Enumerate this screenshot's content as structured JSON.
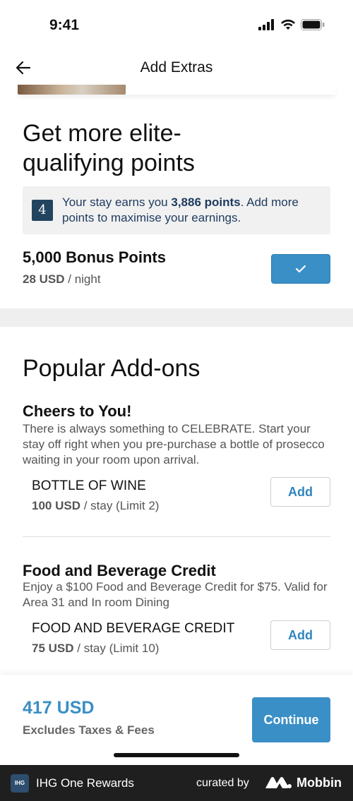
{
  "status_bar": {
    "time": "9:41"
  },
  "nav": {
    "title": "Add Extras"
  },
  "points_section": {
    "title_line1": "Get more elite-",
    "title_line2": "qualifying points",
    "info_prefix": "Your stay earns you ",
    "info_points": "3,886 points",
    "info_suffix": ". Add more points to maximise your earnings.",
    "bonus_title": "5,000 Bonus Points",
    "bonus_price": "28 USD",
    "bonus_unit": " / night",
    "selected": true
  },
  "popular": {
    "title": "Popular Add-ons",
    "addons": [
      {
        "heading": "Cheers to You!",
        "description": "There is always something to CELEBRATE. Start your stay off right when you pre-purchase a bottle of prosecco waiting in your room upon arrival.",
        "item": "BOTTLE OF WINE",
        "price": "100 USD",
        "unit": " / stay (Limit 2)",
        "button": "Add"
      },
      {
        "heading": "Food and Beverage Credit",
        "description": "Enjoy a $100 Food and Beverage Credit for $75. Valid for Area 31 and In room Dining",
        "item": "FOOD AND BEVERAGE CREDIT",
        "price": "75 USD",
        "unit": " / stay (Limit 10)",
        "button": "Add"
      }
    ]
  },
  "footer": {
    "total": "417 USD",
    "note": "Excludes Taxes & Fees",
    "continue": "Continue"
  },
  "banner": {
    "logo_text": "IHG",
    "app_name": "IHG One Rewards",
    "curated_by": "curated by",
    "brand": "Mobbin"
  },
  "colors": {
    "accent": "#3a8fc6",
    "navy": "#1e3a5f",
    "banner_bg": "#1f1f1f"
  }
}
